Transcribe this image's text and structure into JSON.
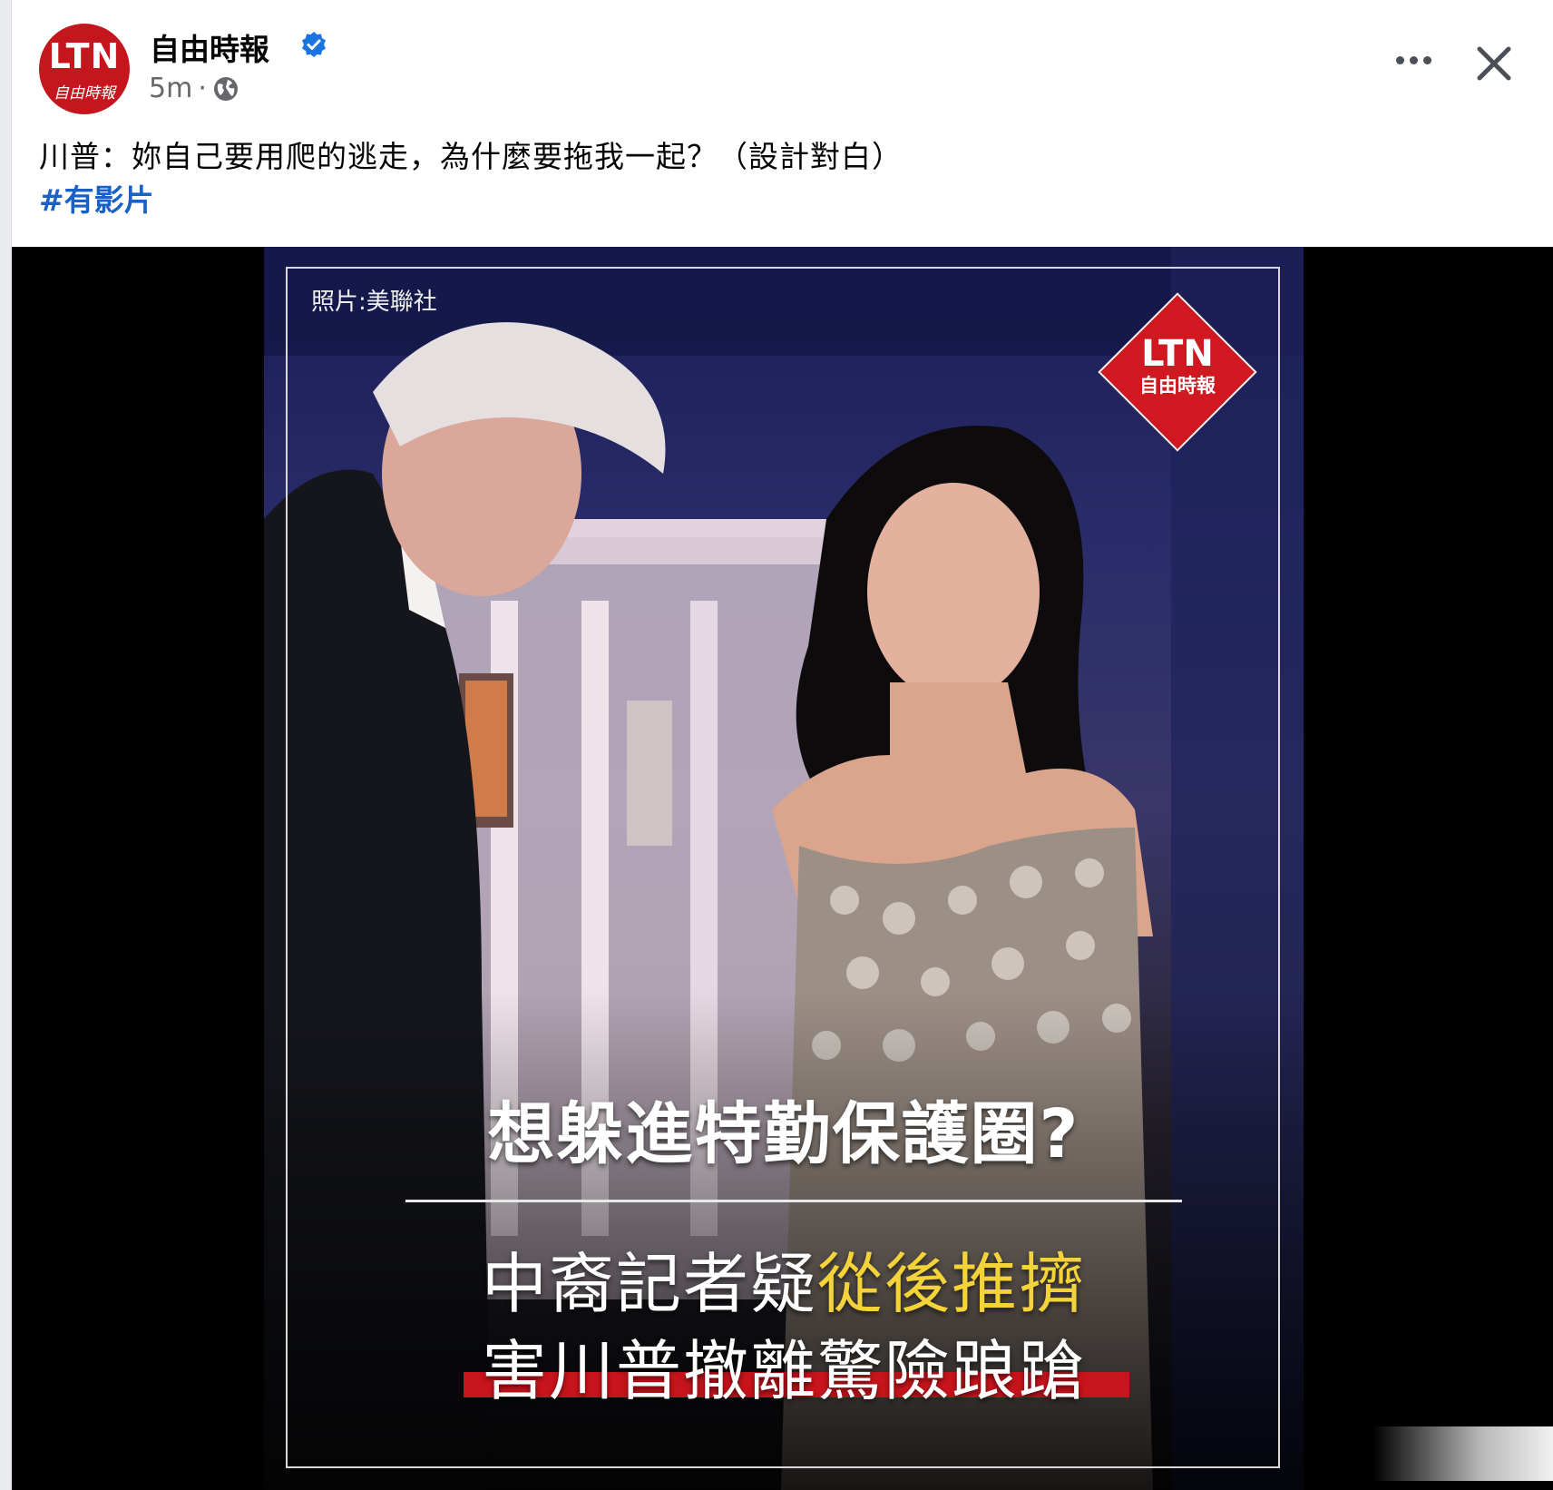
{
  "post": {
    "page_name": "自由時報",
    "avatar": {
      "ltn": "LTN",
      "sub": "自由時報"
    },
    "time": "5m",
    "separator": "·",
    "caption": "川普：妳自己要用爬的逃走，為什麼要拖我一起？（設計對白）",
    "hashtag": "#有影片",
    "icons": [
      "verified-badge-icon",
      "globe-icon",
      "more-icon",
      "close-icon"
    ]
  },
  "media": {
    "credit": "照片:美聯社",
    "logo": {
      "big": "LTN",
      "small": "自由時報"
    },
    "headline": "想躲進特勤保護圈?",
    "subline1_plain": "中裔記者疑",
    "subline1_highlight": "從後推擠",
    "subline2": "害川普撤離驚險踉蹌"
  },
  "colors": {
    "brand_red": "#c4161c",
    "hashtag_blue": "#1a61c6",
    "verified_blue": "#1b74e4",
    "highlight_yellow": "#f4d23a"
  }
}
